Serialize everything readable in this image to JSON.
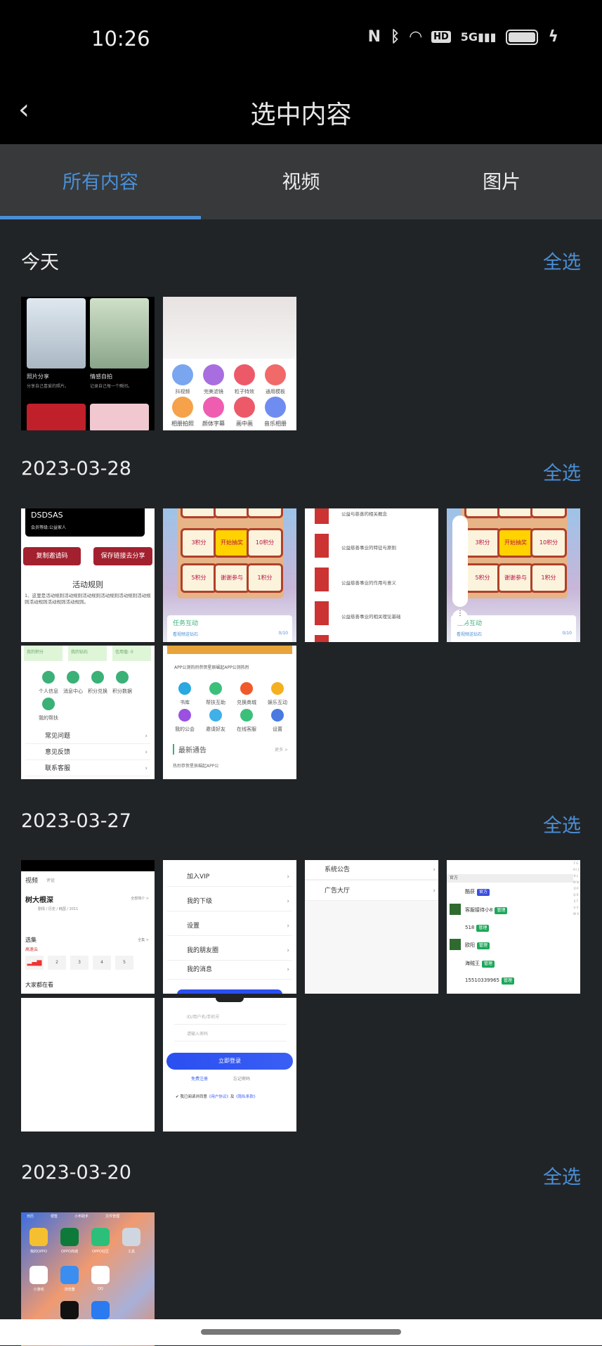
{
  "status_bar": {
    "time": "10:26",
    "icons": [
      "nfc-icon",
      "bluetooth-icon",
      "wifi-icon",
      "hd-icon",
      "5g-signal-icon",
      "battery-icon",
      "charging-icon"
    ]
  },
  "header": {
    "title": "选中内容",
    "back_icon": "chevron-left-icon"
  },
  "tabs": [
    {
      "label": "所有内容",
      "active": true
    },
    {
      "label": "视频",
      "active": false
    },
    {
      "label": "图片",
      "active": false
    }
  ],
  "colors": {
    "accent": "#4a8fd6",
    "background": "#212427",
    "tabbar": "#37393b"
  },
  "sections": [
    {
      "date": "今天",
      "select_all": "全选"
    },
    {
      "date": "2023-03-28",
      "select_all": "全选"
    },
    {
      "date": "2023-03-27",
      "select_all": "全选"
    },
    {
      "date": "2023-03-20",
      "select_all": "全选"
    }
  ],
  "thumbs": {
    "t1": {
      "c1_title": "照片分享",
      "c1_sub": "分享自己喜爱的照片。",
      "c2_title": "情感自拍",
      "c2_sub": "记录自己每一个瞬间。"
    },
    "t2": {
      "items": [
        "抖视频",
        "完美滤镜",
        "粒子特效",
        "通用模板",
        "相册拍照",
        "颜体字幕",
        "画中画",
        "音乐相册"
      ]
    },
    "t3": {
      "name": "DSDSAS",
      "level": "会员等级:公益家人",
      "btn1": "复制邀请码",
      "btn2": "保存链接去分享",
      "rules_title": "活动规则",
      "rules_text": "1、这里是活动规则活动规则活动规则活动规则活动规则活动规则活动规则活动规则活动规则。"
    },
    "t4": {
      "cells": [
        "3积分",
        "开始抽奖",
        "10积分",
        "5积分",
        "谢谢参与",
        "1积分"
      ],
      "task": "任务互动",
      "task_item": "看视频送钻石",
      "progress": "0/10"
    },
    "t5": {
      "items": [
        "公益与慈善的相关概念",
        "公益慈善事业的特征与原则",
        "公益慈善事业的作用与意义",
        "公益慈善事业的相关理论基础"
      ]
    },
    "t7": {
      "stats": [
        "我的积分",
        "我的钻石",
        "信用值: 0"
      ],
      "icons": [
        "个人信息",
        "消息中心",
        "积分兑换",
        "积分数据",
        "我的帮扶"
      ],
      "menu": [
        "常见问题",
        "意见反馈",
        "联系客服"
      ]
    },
    "t8": {
      "notice": "APP公测热烈恭贺星辰崛起APP公测热烈",
      "icons": [
        "书库",
        "帮扶互助",
        "兑换商城",
        "娱乐互动",
        "我的公会",
        "邀请好友",
        "在线客服",
        "设置"
      ],
      "news_title": "最新通告",
      "more": "更多 >",
      "news_item": "热烈恭贺星辰崛起APP公"
    },
    "t9": {
      "tabs": [
        "视频",
        "评论"
      ],
      "title": "树大根深",
      "intro": "全部简介 >",
      "meta": "剧情 / 历史 / 韩国 / 2011",
      "select": "选集",
      "all": "全集 >",
      "source": "高速云",
      "eps": [
        "2",
        "3",
        "4",
        "5"
      ],
      "watching": "大家都在看"
    },
    "t10": {
      "items": [
        "加入VIP",
        "我的下级",
        "设置",
        "我的朋友圈",
        "我的消息"
      ]
    },
    "t11": {
      "items": [
        "系统公告",
        "广告大厅"
      ]
    },
    "t12": {
      "header": "官方",
      "contacts": [
        {
          "name": "酷获",
          "tag": "官方"
        },
        {
          "name": "客服接待小8",
          "tag": "管理"
        },
        {
          "name": "518",
          "tag": "管理"
        },
        {
          "name": "欧阳",
          "tag": "管理"
        },
        {
          "name": "海贼王",
          "tag": "管理"
        },
        {
          "name": "15510339965",
          "tag": "管理"
        }
      ]
    },
    "t14": {
      "user_placeholder": "ID/用户名/手机号",
      "pass_placeholder": "请输入密码",
      "login": "立即登录",
      "register": "免费注册",
      "forgot": "忘记密码",
      "agree": "我已阅读并同意",
      "agreement": "《用户协议》",
      "and": "及",
      "privacy": "《隐私条款》"
    },
    "t15": {
      "tabs": [
        "日历",
        "便签",
        "小布助手",
        "文件管理"
      ],
      "apps": [
        "我的OPPO",
        "OPPO商城",
        "OPPO社区",
        "工具",
        "小游戏",
        "浏览器",
        "QQ"
      ]
    }
  },
  "nav": {
    "handle": "home-indicator"
  }
}
